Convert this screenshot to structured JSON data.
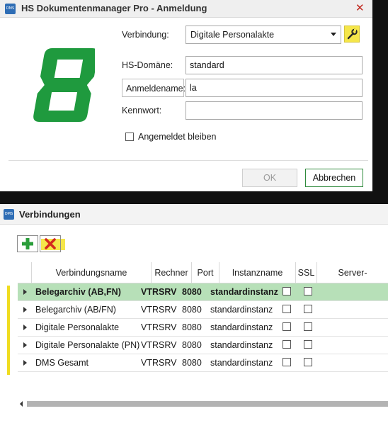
{
  "login": {
    "title": "HS Dokumentenmanager Pro - Anmeldung",
    "app_icon_text": "DMS",
    "close_glyph": "✕",
    "fields": {
      "connection_label": "Verbindung:",
      "connection_value": "Digitale Personalakte",
      "domain_label": "HS-Domäne:",
      "domain_value": "standard",
      "username_label": "Anmeldename:",
      "username_value": "la",
      "password_label": "Kennwort:",
      "password_value": ""
    },
    "remember_label": "Angemeldet bleiben",
    "remember_checked": false,
    "ok_label": "OK",
    "cancel_label": "Abbrechen",
    "logo_digit": "8",
    "logo_color": "#1f9a3e",
    "wrench_icon": "wrench-icon"
  },
  "connections": {
    "title": "Verbindungen",
    "app_icon_text": "DMS",
    "toolbar": {
      "add_icon": "plus-icon",
      "delete_icon": "delete-x-icon"
    },
    "columns": [
      "Verbindungsname",
      "Rechner",
      "Port",
      "Instanzname",
      "SSL",
      "Server-Zertifizierung"
    ],
    "rows": [
      {
        "name": "Belegarchiv (AB,FN)",
        "host": "VTRSRV",
        "port": "8080",
        "instance": "standardinstanz",
        "ssl": false,
        "cert": false,
        "selected": true
      },
      {
        "name": "Belegarchiv (AB/FN)",
        "host": "VTRSRV",
        "port": "8080",
        "instance": "standardinstanz",
        "ssl": false,
        "cert": false,
        "selected": false
      },
      {
        "name": "Digitale Personalakte",
        "host": "VTRSRV",
        "port": "8080",
        "instance": "standardinstanz",
        "ssl": false,
        "cert": false,
        "selected": false
      },
      {
        "name": "Digitale Personalakte (PN)",
        "host": "VTRSRV",
        "port": "8080",
        "instance": "standardinstanz",
        "ssl": false,
        "cert": false,
        "selected": false
      },
      {
        "name": "DMS Gesamt",
        "host": "VTRSRV",
        "port": "8080",
        "instance": "standardinstanz",
        "ssl": false,
        "cert": false,
        "selected": false
      }
    ]
  },
  "colors": {
    "accent_green": "#2f8a3c",
    "highlight_yellow": "#f5e64a",
    "selected_row": "#b7e0b8",
    "close_red": "#c0281e"
  }
}
